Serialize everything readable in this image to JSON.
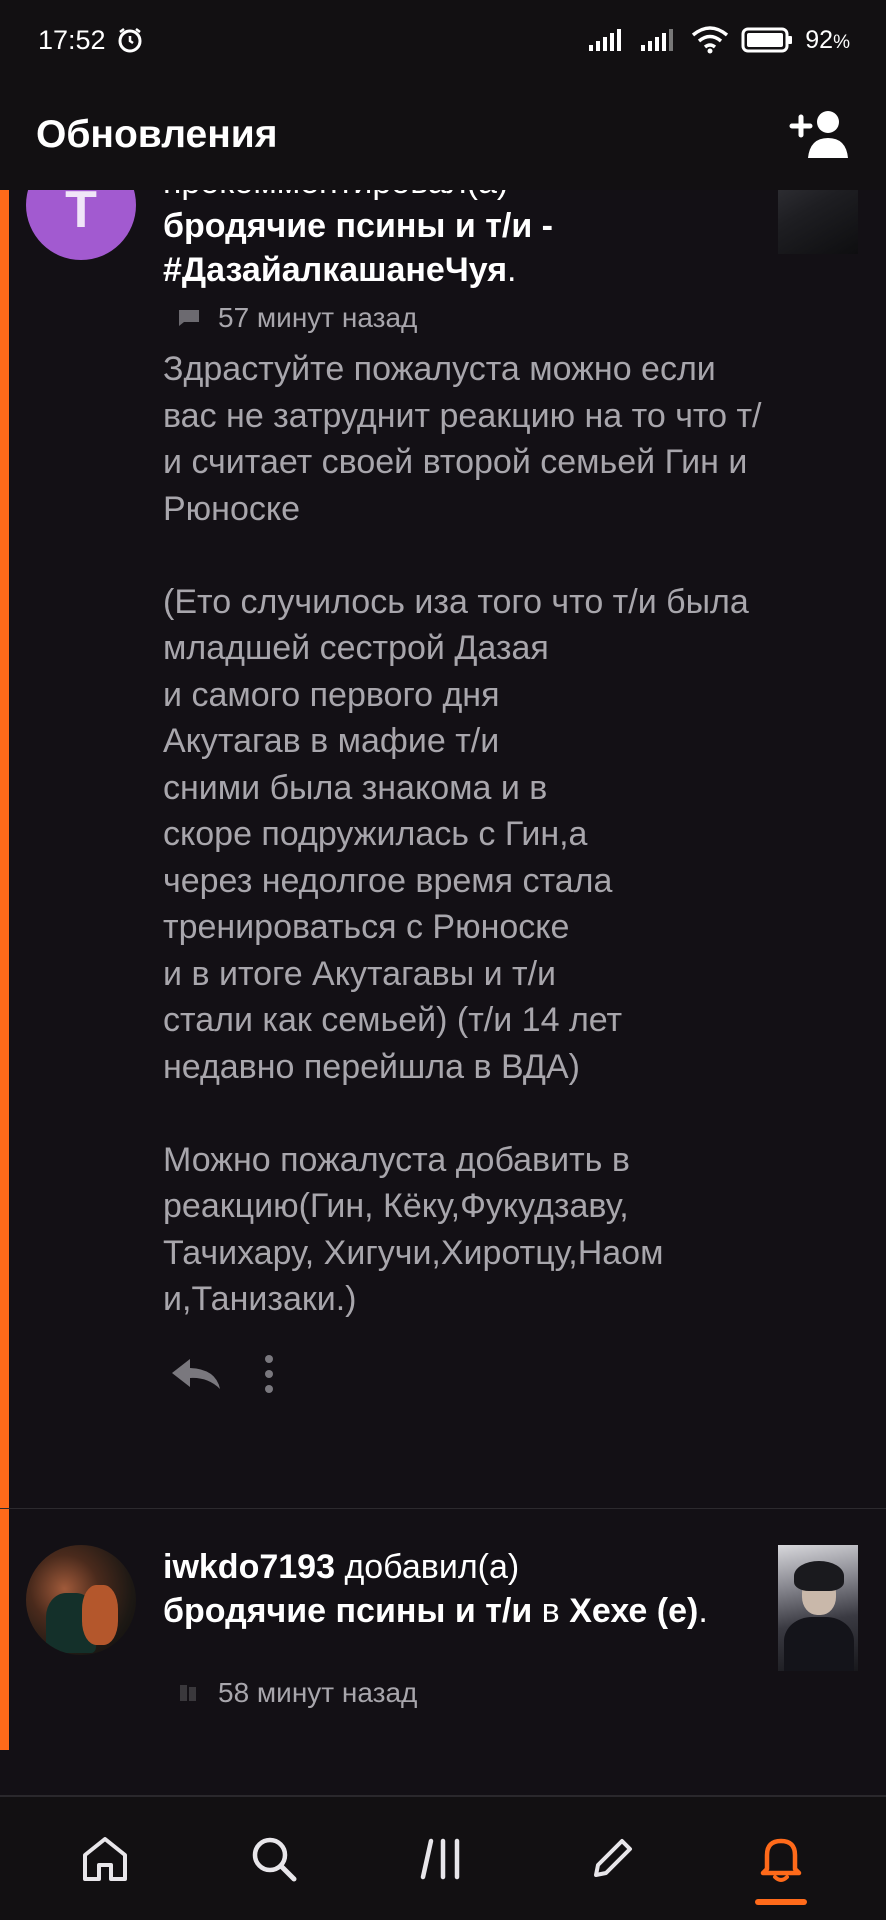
{
  "status_bar": {
    "time": "17:52",
    "battery": "92",
    "battery_unit": "%",
    "icons": [
      "alarm-icon",
      "signal-icon",
      "signal-icon-2",
      "wifi-icon",
      "battery-icon"
    ]
  },
  "header": {
    "title": "Обновления",
    "action_icon": "add-user-icon"
  },
  "feed": {
    "items": [
      {
        "avatar_letter": "Т",
        "verb": "прокомментировал(а)",
        "story_title": "бродячие псины и т/и - #ДазайалкашанеЧуя",
        "suffix": ".",
        "time": "57 минут назад",
        "meta_icon": "comment-icon",
        "comment": "Здрастуйте пожалуста можно если вас не затруднит реакцию на то что т/и считает своей второй семьей Гин и Рюноске\n\n(Ето случилось иза того что т/и была\nмладшей сестрой Дазая\nи самого первого дня\nАкутагав в мафие т/и\nсними была знакома и в\nскоре подружилась с Гин,а\nчерез недолгое время стала\nтренироваться с Рюноске\nи в итоге Акутагавы и т/и\nстали как семьей) (т/и 14 лет\nнедавно перейшла в ВДА)\n\nМожно пожалуста добавить в реакцию(Гин, Кёку,Фукудзаву,\nТачихару, Хигучи,Хиротцу,Наом\nи,Танизаки.)",
        "actions": [
          "reply-icon",
          "more-icon"
        ]
      },
      {
        "username": "iwkdo7193",
        "verb": "добавил(а)",
        "story_title": "бродячие псины и т/и",
        "connector": "в",
        "collection": "Хехе (е)",
        "suffix": ".",
        "time": "58 минут назад",
        "meta_icon": "library-icon"
      }
    ]
  },
  "bottom_nav": {
    "items": [
      "home-icon",
      "search-icon",
      "library-icon",
      "write-icon",
      "notifications-icon"
    ],
    "active": "notifications-icon"
  },
  "colors": {
    "background": "#131015",
    "accent": "#ff6a1a",
    "secondary_text": "#a8a6ac",
    "avatar": "#a25ad0"
  }
}
